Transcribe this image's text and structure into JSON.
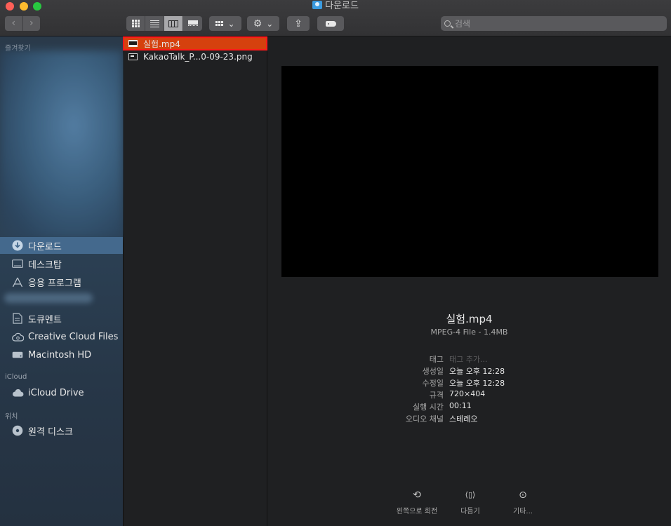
{
  "window": {
    "title": "다운로드"
  },
  "toolbar": {
    "back": "‹",
    "forward": "›",
    "action_glyph": "⚙",
    "share_glyph": "⇪",
    "chevron": "⌄",
    "search_placeholder": "검색"
  },
  "sidebar": {
    "favorites_header": "즐겨찾기",
    "items": [
      {
        "label": "다운로드",
        "icon": "downloads-icon"
      },
      {
        "label": "데스크탑",
        "icon": "desktop-icon"
      },
      {
        "label": "응용 프로그램",
        "icon": "applications-icon"
      },
      {
        "label": "도큐멘트",
        "icon": "documents-icon"
      },
      {
        "label": "Creative Cloud Files",
        "icon": "creative-cloud-icon"
      },
      {
        "label": "Macintosh HD",
        "icon": "disk-icon"
      }
    ],
    "icloud_header": "iCloud",
    "icloud_items": [
      {
        "label": "iCloud Drive",
        "icon": "cloud-icon"
      }
    ],
    "locations_header": "위치",
    "location_items": [
      {
        "label": "원격 디스크",
        "icon": "remote-disc-icon"
      }
    ]
  },
  "files": [
    {
      "name": "실험.mp4",
      "selected": true
    },
    {
      "name": "KakaoTalk_P...0-09-23.png",
      "selected": false
    }
  ],
  "preview": {
    "name": "실험.mp4",
    "kind": "MPEG-4 File - 1.4MB",
    "meta": [
      {
        "key": "태그",
        "value": "태그 추가..."
      },
      {
        "key": "생성일",
        "value": "오늘 오후 12:28"
      },
      {
        "key": "수정일",
        "value": "오늘 오후 12:28"
      },
      {
        "key": "규격",
        "value": "720×404"
      },
      {
        "key": "실행 시간",
        "value": "00:11"
      },
      {
        "key": "오디오 채널",
        "value": "스테레오"
      }
    ],
    "actions": [
      {
        "label": "왼쪽으로 회전",
        "icon": "rotate-left-icon",
        "glyph": "⟲"
      },
      {
        "label": "다듬기",
        "icon": "trim-icon",
        "glyph": "⟨▯⟩"
      },
      {
        "label": "기타...",
        "icon": "more-icon",
        "glyph": "⊙"
      }
    ]
  },
  "colors": {
    "selection": "#d5410e",
    "sidebar_selection": "#44698d",
    "highlight_outline": "#ff1a1a"
  }
}
